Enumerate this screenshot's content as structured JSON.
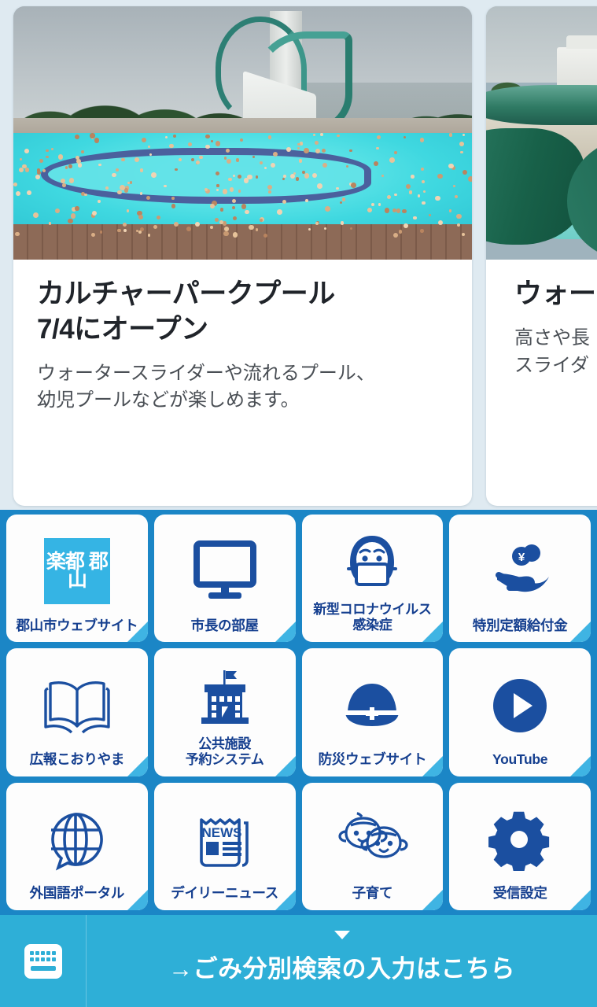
{
  "carousel": {
    "cards": [
      {
        "image_alt": "wave-pool-photo",
        "title": "カルチャーパークプール\n7/4にオープン",
        "description": "ウォータースライダーや流れるプール、\n幼児プールなどが楽しめます。"
      },
      {
        "image_alt": "water-slide-photo",
        "title": "ウォー",
        "description": "高さや長\nスライダ"
      }
    ]
  },
  "grid": {
    "items": [
      {
        "label": "郡山市ウェブサイト",
        "icon": "koriyama-logo-icon",
        "logo_text": "楽都\n郡山"
      },
      {
        "label": "市長の部屋",
        "icon": "monitor-icon"
      },
      {
        "label": "新型コロナウイルス\n感染症",
        "icon": "face-mask-icon"
      },
      {
        "label": "特別定額給付金",
        "icon": "hand-yen-coin-icon"
      },
      {
        "label": "広報こおりやま",
        "icon": "open-book-icon"
      },
      {
        "label": "公共施設\n予約システム",
        "icon": "government-building-icon"
      },
      {
        "label": "防災ウェブサイト",
        "icon": "safety-helmet-icon"
      },
      {
        "label": "YouTube",
        "icon": "play-circle-icon"
      },
      {
        "label": "外国語ポータル",
        "icon": "globe-speech-icon"
      },
      {
        "label": "デイリーニュース",
        "icon": "newspaper-icon",
        "news_text": "NEWS"
      },
      {
        "label": "子育て",
        "icon": "children-faces-icon"
      },
      {
        "label": "受信設定",
        "icon": "gear-icon"
      }
    ]
  },
  "bottom_bar": {
    "keyboard_icon": "keyboard-icon",
    "caret_icon": "caret-down-icon",
    "text": "→ごみ分別検索の入力はこちら"
  },
  "colors": {
    "grid_background": "#1b86c6",
    "bottom_bar": "#2eafd7",
    "page_background": "#dfeaf1",
    "tile_corner": "#3fb4e3",
    "label_text": "#153f8f",
    "logo_tile": "#35b4e4"
  }
}
